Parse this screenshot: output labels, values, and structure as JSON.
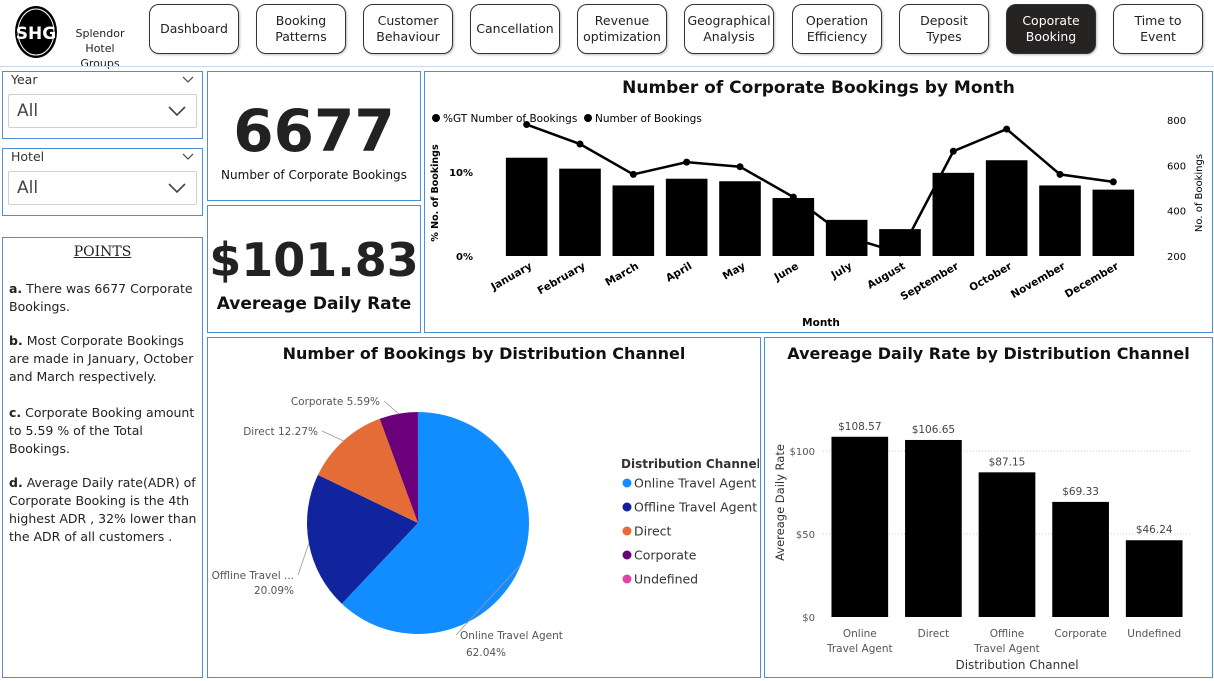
{
  "brand": {
    "line1": "Splendor Hotel",
    "line2": "Groups",
    "logo_text": "SHG"
  },
  "nav": {
    "items": [
      {
        "id": "dashboard",
        "label_1": "Dashboard",
        "label_2": ""
      },
      {
        "id": "booking-patterns",
        "label_1": "Booking",
        "label_2": "Patterns"
      },
      {
        "id": "customer-behaviour",
        "label_1": "Customer",
        "label_2": "Behaviour"
      },
      {
        "id": "cancellation",
        "label_1": "Cancellation",
        "label_2": ""
      },
      {
        "id": "revenue-optimization",
        "label_1": "Revenue",
        "label_2": "optimization"
      },
      {
        "id": "geographical-analysis",
        "label_1": "Geographical",
        "label_2": "Analysis"
      },
      {
        "id": "operation-efficiency",
        "label_1": "Operation",
        "label_2": "Efficiency"
      },
      {
        "id": "deposit-types",
        "label_1": "Deposit Types",
        "label_2": ""
      },
      {
        "id": "corporate-booking",
        "label_1": "Coporate",
        "label_2": "Booking"
      },
      {
        "id": "time-to-event",
        "label_1": "Time to Event",
        "label_2": ""
      }
    ],
    "active": "corporate-booking"
  },
  "slicers": {
    "year": {
      "label": "Year",
      "value": "All"
    },
    "hotel": {
      "label": "Hotel",
      "value": "All"
    }
  },
  "points": {
    "title": "POINTS",
    "items": [
      {
        "marker": "a.",
        "text": "There was 6677 Corporate Bookings."
      },
      {
        "marker": "b.",
        "text": "Most Corporate Bookings are made in January, October and March respectively."
      },
      {
        "marker": "c.",
        "text": "Corporate Booking amount to 5.59 % of the Total Bookings."
      },
      {
        "marker": "d.",
        "text": "Average Daily rate(ADR) of Corporate Booking is the 4th highest ADR , 32% lower than the ADR of all customers ."
      }
    ]
  },
  "kpis": {
    "bookings": {
      "value": "6677",
      "label": "Number of Corporate Bookings"
    },
    "adr": {
      "value": "$101.83",
      "label": "Avereage Daily Rate"
    }
  },
  "colors": {
    "panel_border": "#4a90d9",
    "bar": "#000000",
    "online_travel_agent": "#118dff",
    "offline_travel_agent": "#12239e",
    "direct": "#e66c37",
    "corporate": "#6b007b",
    "undefined": "#e044a7"
  },
  "chart_data": [
    {
      "type": "bar",
      "title": "Number of Corporate Bookings by Month",
      "xlabel": "Month",
      "ylabel": "% No. of Bookings",
      "y2label": "No. of Bookings",
      "categories": [
        "January",
        "February",
        "March",
        "April",
        "May",
        "June",
        "July",
        "August",
        "September",
        "October",
        "November",
        "December"
      ],
      "series": [
        {
          "name": "%GT Number of Bookings",
          "kind": "bar",
          "values": [
            11.7,
            10.4,
            8.4,
            9.2,
            8.9,
            6.9,
            4.3,
            3.2,
            9.9,
            11.4,
            8.4,
            7.9
          ]
        },
        {
          "name": "Number of Bookings",
          "kind": "line",
          "values": [
            780,
            694,
            560,
            614,
            594,
            460,
            285,
            214,
            662,
            760,
            560,
            527
          ]
        }
      ],
      "ylim": [
        0,
        15
      ],
      "y_ticks": [
        "0%",
        "10%"
      ],
      "y2lim": [
        200,
        800
      ],
      "y2_ticks": [
        "200",
        "400",
        "600",
        "800"
      ],
      "legend": "top-left"
    },
    {
      "type": "pie",
      "title": "Number of Bookings by Distribution Channel",
      "legend_title": "Distribution Channel",
      "legend": "right",
      "slices": [
        {
          "label": "Online Travel Agent",
          "short_label": "Online Travel Agent",
          "value": 62.04,
          "display": "62.04%"
        },
        {
          "label": "Offline Travel Agent",
          "short_label": "Offline Travel ...",
          "value": 20.09,
          "display": "20.09%"
        },
        {
          "label": "Direct",
          "short_label": "Direct",
          "value": 12.27,
          "display": "12.27%"
        },
        {
          "label": "Corporate",
          "short_label": "Corporate",
          "value": 5.59,
          "display": "5.59%"
        },
        {
          "label": "Undefined",
          "short_label": "Undefined",
          "value": 0.01,
          "display": ""
        }
      ]
    },
    {
      "type": "bar",
      "title": "Avereage Daily Rate by Distribution Channel",
      "xlabel": "Distribution Channel",
      "ylabel": "Avereage Daily Rate",
      "categories": [
        "Online Travel Agent",
        "Direct",
        "Offline Travel Agent",
        "Corporate",
        "Undefined"
      ],
      "values": [
        108.57,
        106.65,
        87.15,
        69.33,
        46.24
      ],
      "value_labels": [
        "$108.57",
        "$106.65",
        "$87.15",
        "$69.33",
        "$46.24"
      ],
      "ylim": [
        0,
        150
      ],
      "y_ticks": [
        "$0",
        "$50",
        "$100"
      ],
      "grid": true
    }
  ]
}
